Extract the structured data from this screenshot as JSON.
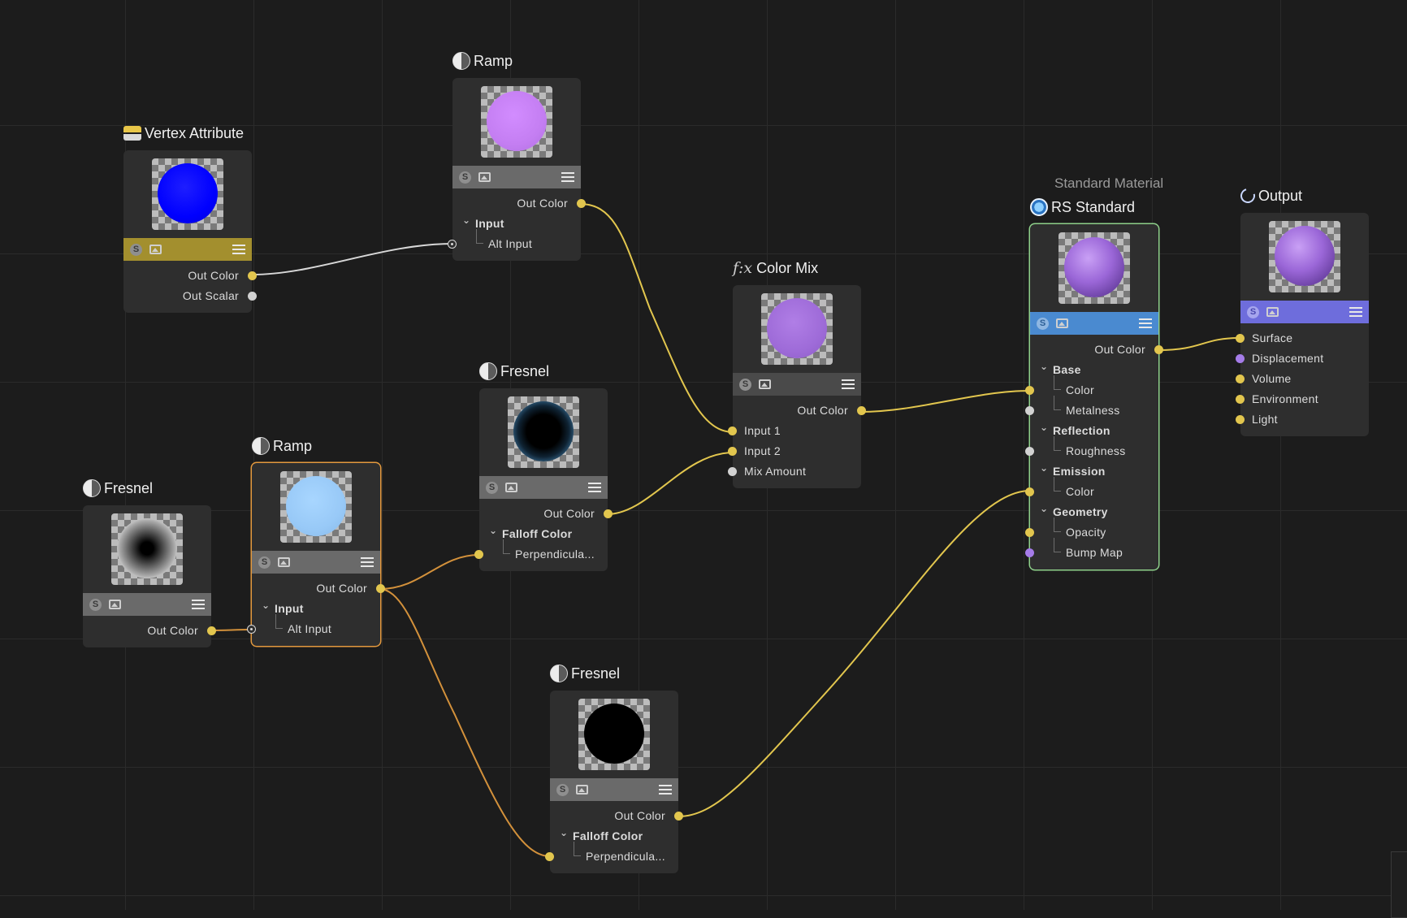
{
  "nodes": {
    "vertex": {
      "title": "Vertex Attribute",
      "ports": [
        "Out Color",
        "Out Scalar"
      ]
    },
    "ramp_top": {
      "title": "Ramp",
      "out": "Out Color",
      "group": "Input",
      "sub": "Alt Input"
    },
    "fresnel_left": {
      "title": "Fresnel",
      "out": "Out Color"
    },
    "ramp_mid": {
      "title": "Ramp",
      "out": "Out Color",
      "group": "Input",
      "sub": "Alt Input"
    },
    "fresnel_mid": {
      "title": "Fresnel",
      "out": "Out Color",
      "group": "Falloff Color",
      "sub": "Perpendicula..."
    },
    "fresnel_bottom": {
      "title": "Fresnel",
      "out": "Out Color",
      "group": "Falloff Color",
      "sub": "Perpendicula..."
    },
    "colormix": {
      "icon": "f:x",
      "title": "Color Mix",
      "out": "Out Color",
      "inputs": [
        "Input 1",
        "Input 2",
        "Mix Amount"
      ]
    },
    "rs": {
      "subtitle": "Standard Material",
      "title": "RS Standard",
      "out": "Out Color",
      "groups": [
        {
          "label": "Base",
          "items": [
            "Color",
            "Metalness"
          ]
        },
        {
          "label": "Reflection",
          "items": [
            "Roughness"
          ]
        },
        {
          "label": "Emission",
          "items": [
            "Color"
          ]
        },
        {
          "label": "Geometry",
          "items": [
            "Opacity",
            "Bump Map"
          ]
        }
      ]
    },
    "output": {
      "title": "Output",
      "inputs": [
        "Surface",
        "Displacement",
        "Volume",
        "Environment",
        "Light"
      ]
    }
  },
  "colors": {
    "wire_yellow": "#e2c64e",
    "wire_orange": "#d3913b",
    "wire_white": "#d8d8d8",
    "vertex_toolbar": "#a38f2e",
    "rs_toolbar": "#4a8ad0",
    "output_toolbar": "#6e6ddc",
    "gray_toolbar": "#6a6a6a"
  }
}
